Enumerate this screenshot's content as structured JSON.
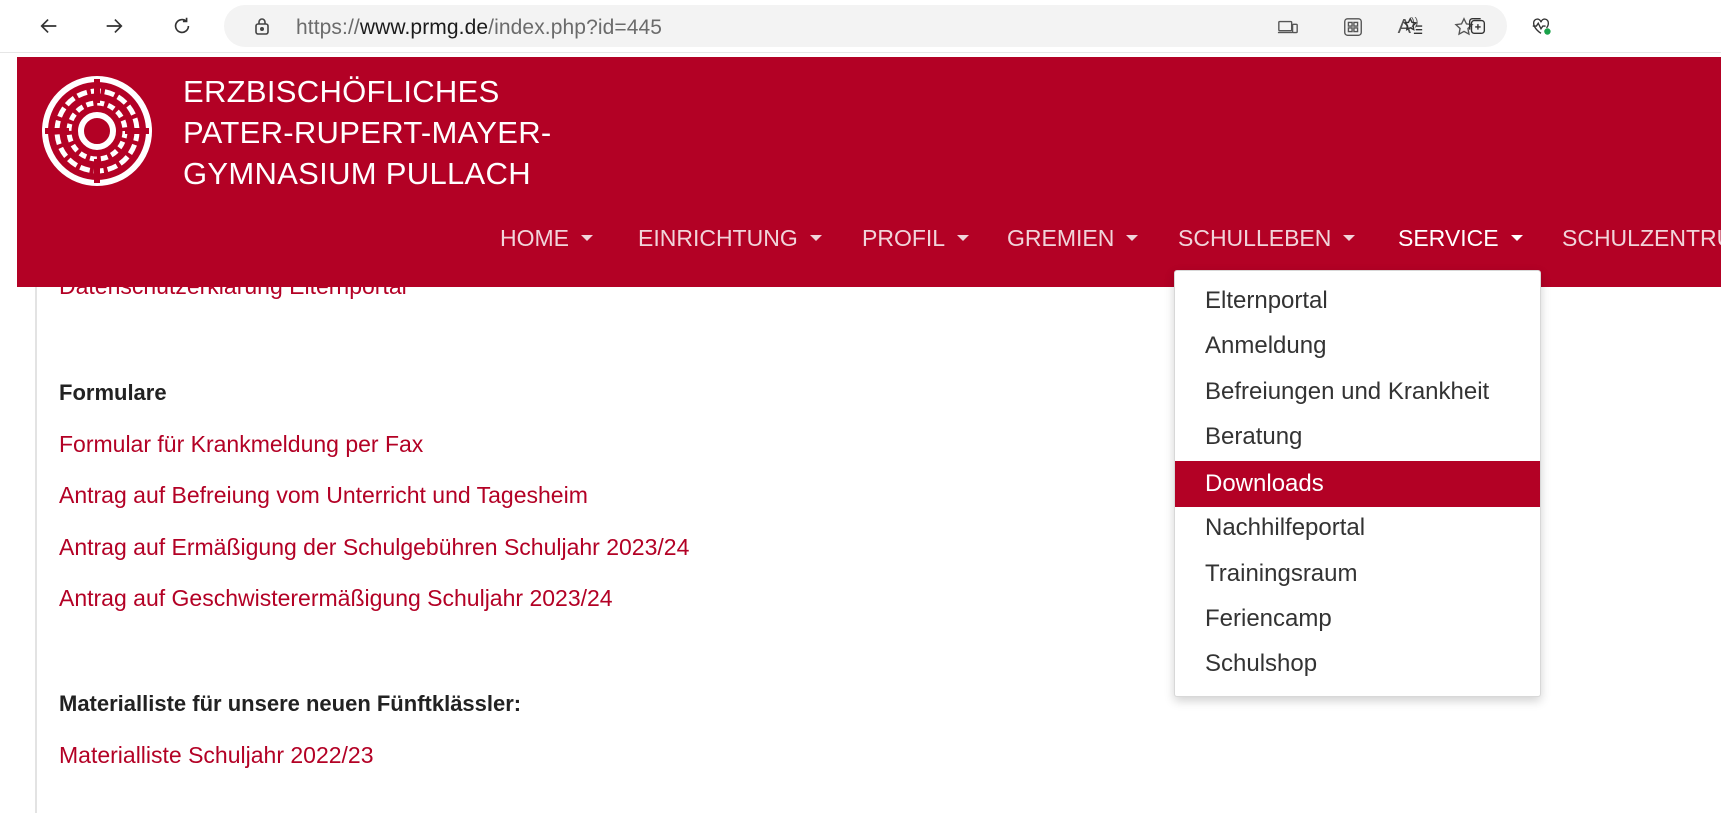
{
  "browser": {
    "url_prefix": "https://",
    "url_host": "www.prmg.de",
    "url_path": "/index.php?id=445",
    "toolbar_icons": [
      "back-icon",
      "forward-icon",
      "refresh-icon",
      "lock-icon",
      "devices-icon",
      "apps-icon",
      "read-aloud-icon",
      "favorite-star-icon",
      "favorites-icon",
      "collections-icon",
      "browser-health-icon"
    ],
    "read_aloud_label": "A"
  },
  "site": {
    "name_lines": [
      "ERZBISCHÖFLICHES",
      "PATER-RUPERT-MAYER-",
      "GYMNASIUM PULLACH"
    ],
    "brand_color": "#b30125",
    "nav": [
      {
        "label": "HOME"
      },
      {
        "label": "EINRICHTUNG"
      },
      {
        "label": "PROFIL"
      },
      {
        "label": "GREMIEN"
      },
      {
        "label": "SCHULLEBEN"
      },
      {
        "label": "SERVICE"
      },
      {
        "label": "SCHULZENTRU"
      }
    ]
  },
  "service_menu": {
    "items": [
      {
        "label": "Elternportal"
      },
      {
        "label": "Anmeldung"
      },
      {
        "label": "Befreiungen und Krankheit"
      },
      {
        "label": "Beratung"
      },
      {
        "label": "Downloads"
      },
      {
        "label": "Nachhilfeportal"
      },
      {
        "label": "Trainingsraum"
      },
      {
        "label": "Feriencamp"
      },
      {
        "label": "Schulshop"
      }
    ],
    "selected": "Downloads"
  },
  "content": {
    "partial_link": "Datenschutzerklärung Elternportal",
    "formulare_heading": "Formulare",
    "formulare_links": [
      "Formular für Krankmeldung per Fax",
      "Antrag auf Befreiung vom Unterricht und Tagesheim",
      "Antrag auf Ermäßigung der Schulgebühren Schuljahr 2023/24",
      "Antrag auf Geschwisterermäßigung Schuljahr 2023/24"
    ],
    "material_heading": "Materialliste für unsere neuen Fünftklässler:",
    "material_links": [
      "Materialliste Schuljahr 2022/23"
    ]
  }
}
